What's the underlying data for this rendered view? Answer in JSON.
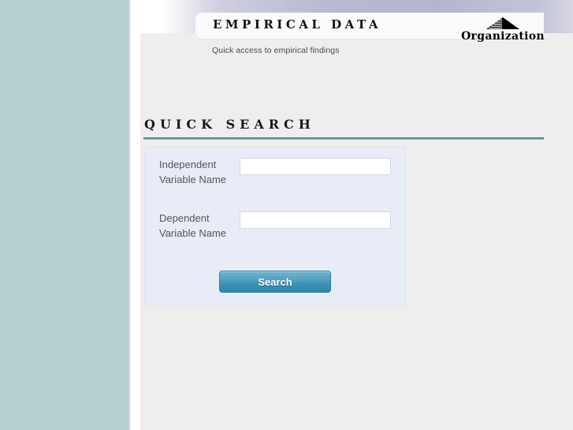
{
  "header": {
    "site_title": "EMPIRICAL  DATA",
    "tagline": "Quick access to empirical findings",
    "organization_name": "Organization",
    "logo_icon": "mountain-pyramid-icon"
  },
  "section": {
    "heading": "QUICK  SEARCH"
  },
  "search_form": {
    "fields": [
      {
        "label": "Independent Variable Name",
        "value": "",
        "placeholder": ""
      },
      {
        "label": "Dependent Variable Name",
        "value": "",
        "placeholder": ""
      }
    ],
    "submit_label": "Search"
  },
  "colors": {
    "sidebar": "#b6d0d0",
    "banner_gradient_end": "#b5b5cf",
    "content_background": "#eeeeee",
    "panel_background": "#e8ecf7",
    "rule": "#5d8e92",
    "button_top": "#6fb5d0",
    "button_bottom": "#2f85ab",
    "label_text": "#555555"
  }
}
